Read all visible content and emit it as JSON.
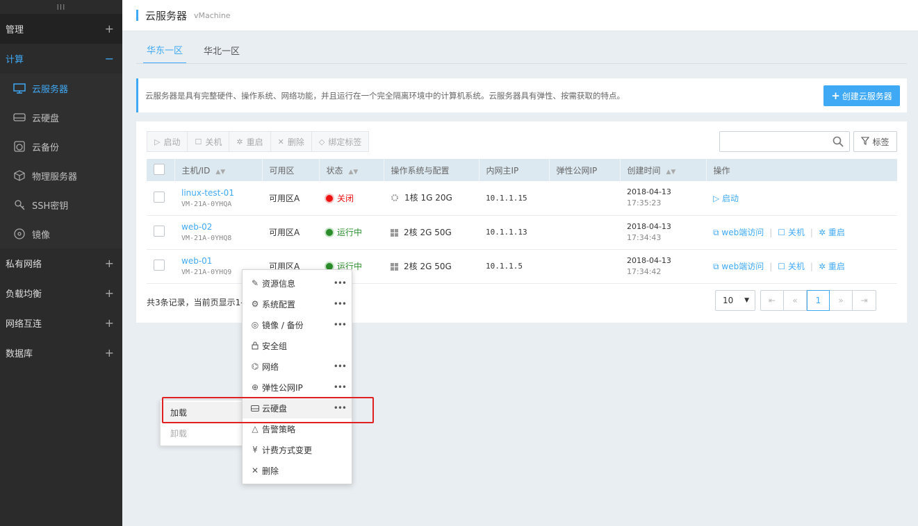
{
  "sidebar": {
    "handle": "III",
    "groups": [
      {
        "label": "管理",
        "sign": "+"
      },
      {
        "label": "计算",
        "sign": "−"
      },
      {
        "label": "私有网络",
        "sign": "+"
      },
      {
        "label": "负载均衡",
        "sign": "+"
      },
      {
        "label": "网络互连",
        "sign": "+"
      },
      {
        "label": "数据库",
        "sign": "+"
      }
    ],
    "items": [
      {
        "label": "云服务器",
        "icon": "monitor-icon"
      },
      {
        "label": "云硬盘",
        "icon": "disk-icon"
      },
      {
        "label": "云备份",
        "icon": "backup-icon"
      },
      {
        "label": "物理服务器",
        "icon": "cube-icon"
      },
      {
        "label": "SSH密钥",
        "icon": "key-icon"
      },
      {
        "label": "镜像",
        "icon": "disc-icon"
      }
    ]
  },
  "header": {
    "title": "云服务器",
    "subtitle": "vMachine"
  },
  "tabs": [
    {
      "label": "华东一区"
    },
    {
      "label": "华北一区"
    }
  ],
  "info": {
    "text": "云服务器是具有完整硬件、操作系统、网络功能，并且运行在一个完全隔离环境中的计算机系统。云服务器具有弹性、按需获取的特点。",
    "create_label": "创建云服务器"
  },
  "toolbar": {
    "start": "启动",
    "stop": "关机",
    "restart": "重启",
    "delete": "删除",
    "bind_tag": "绑定标签",
    "tag_label": "标签"
  },
  "table": {
    "headers": [
      "主机/ID",
      "可用区",
      "状态",
      "操作系统与配置",
      "内网主IP",
      "弹性公网IP",
      "创建时间",
      "操作"
    ],
    "rows": [
      {
        "name": "linux-test-01",
        "id": "VM-21A-0YHQA",
        "zone": "可用区A",
        "status": "关闭",
        "config": "1核 1G 20G",
        "ip": "10.1.1.15",
        "date": "2018-04-13",
        "time": "17:35:23",
        "op1": "启动"
      },
      {
        "name": "web-02",
        "id": "VM-21A-0YHQ8",
        "zone": "可用区A",
        "status": "运行中",
        "config": "2核 2G 50G",
        "ip": "10.1.1.13",
        "date": "2018-04-13",
        "time": "17:34:43",
        "op1": "web端访问",
        "op2": "关机",
        "op3": "重启"
      },
      {
        "name": "web-01",
        "id": "VM-21A-0YHQ9",
        "zone": "可用区A",
        "status": "运行中",
        "config": "2核 2G 50G",
        "ip": "10.1.1.5",
        "date": "2018-04-13",
        "time": "17:34:42",
        "op1": "web端访问",
        "op2": "关机",
        "op3": "重启"
      }
    ]
  },
  "footer": {
    "summary": "共3条记录，当前页显示1-",
    "page_size": "10",
    "current_page": "1"
  },
  "context_menu": {
    "items": [
      {
        "label": "资源信息",
        "icon": "edit-icon",
        "more": "•••"
      },
      {
        "label": "系统配置",
        "icon": "settings-icon",
        "more": "•••"
      },
      {
        "label": "镜像 / 备份",
        "icon": "backup-icon",
        "more": "•••"
      },
      {
        "label": "安全组",
        "icon": "lock-icon",
        "more": ""
      },
      {
        "label": "网络",
        "icon": "network-icon",
        "more": "•••"
      },
      {
        "label": "弹性公网IP",
        "icon": "globe-icon",
        "more": "•••"
      },
      {
        "label": "云硬盘",
        "icon": "disk-icon",
        "more": "•••"
      },
      {
        "label": "告警策略",
        "icon": "bell-icon",
        "more": ""
      },
      {
        "label": "计费方式变更",
        "icon": "yen-icon",
        "more": ""
      },
      {
        "label": "删除",
        "icon": "close-icon",
        "more": ""
      }
    ]
  },
  "submenu": {
    "items": [
      {
        "label": "加载"
      },
      {
        "label": "卸载"
      }
    ]
  },
  "colors": {
    "accent": "#3fa9f5",
    "sidebar_bg": "#2b2b2b",
    "status_off": "#e11111",
    "status_on": "#2a8c2a",
    "highlight_box": "#e02020"
  }
}
